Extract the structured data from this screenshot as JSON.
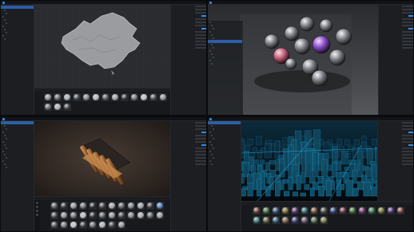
{
  "app": {
    "accent": "#2f8ee6",
    "window_title": "",
    "menu": [
      "",
      "",
      "",
      ""
    ]
  },
  "panels": [
    {
      "id": "map",
      "tree": [
        "",
        "",
        "",
        "",
        "",
        "",
        "",
        "",
        "",
        "",
        ""
      ],
      "selected_index": 0,
      "bottom_tabs": [
        "",
        ""
      ],
      "materials": [
        "#8d8f93",
        "#5d6168",
        "#a9acb0",
        "#3c4047",
        "#7d8086",
        "#b7b9bd",
        "#505359",
        "#9a9da2",
        "#2b2e33",
        "#6f7379",
        "#c0c2c6",
        "#474a50",
        "#8b8e93",
        "#63666c",
        "#aeb1b5",
        "#393c42"
      ]
    },
    {
      "id": "spheres",
      "tree": [
        "",
        "",
        "",
        "",
        "",
        "",
        "",
        "",
        "",
        "",
        "",
        "",
        "",
        ""
      ],
      "selected_index": 6,
      "bottom_tabs": [
        "",
        ""
      ],
      "materials": []
    },
    {
      "id": "cooler",
      "tree": [
        "",
        "",
        "",
        "",
        "",
        "",
        "",
        "",
        "",
        "",
        "",
        "",
        "",
        "",
        ""
      ],
      "selected_index": 0,
      "bottom_tabs": [
        "",
        ""
      ],
      "materials": [
        "#555a60",
        "#2f3237",
        "#8f9399",
        "#6c7075",
        "#2a2c30",
        "#3d4146",
        "#a1a4a8",
        "#5b5f65",
        "#7b7f84",
        "#9ca0a6",
        "#313438",
        "#4a7db8",
        "#44484d",
        "#858a90",
        "#6b6f74",
        "#b6b9bd",
        "#2c2f33",
        "#595d62",
        "#8e9297",
        "#404347",
        "#7a7e83",
        "#a7aaae",
        "#5e6267",
        "#999ca1",
        "#4b4e53",
        "#707479",
        "#c1c3c7",
        "#373a3e",
        "#64686d",
        "#adb0b4",
        "#3a3d42",
        "#8b8f94"
      ]
    },
    {
      "id": "city",
      "tree": [
        "",
        "",
        "",
        "",
        "",
        "",
        "",
        "",
        "",
        "",
        "",
        "",
        "",
        ""
      ],
      "selected_index": 0,
      "bottom_tabs": [
        "",
        ""
      ],
      "materials": [
        "#6b3a2b",
        "#3f6b39",
        "#294b7a",
        "#7a6a2b",
        "#5a2d6b",
        "#2b6b6b",
        "#7a4a2b",
        "#4a4a4a",
        "#2b3b7a",
        "#6b2b3a",
        "#3a6b2b",
        "#7a2b6b",
        "#2b7a4a",
        "#6b6b2b",
        "#4a2b7a",
        "#7a3a3a",
        "#3a7a7a",
        "#5a5a2b",
        "#2b5a7a",
        "#7a5a3a",
        "#3a3a7a",
        "#6b4a6b",
        "#4a6b4a",
        "#7a7a3a"
      ]
    }
  ],
  "colors": {
    "panel_bg": "#1c1e22",
    "selection": "#2d5ea8",
    "city_glow": "#18c0ff",
    "copper": "#b87a44"
  }
}
